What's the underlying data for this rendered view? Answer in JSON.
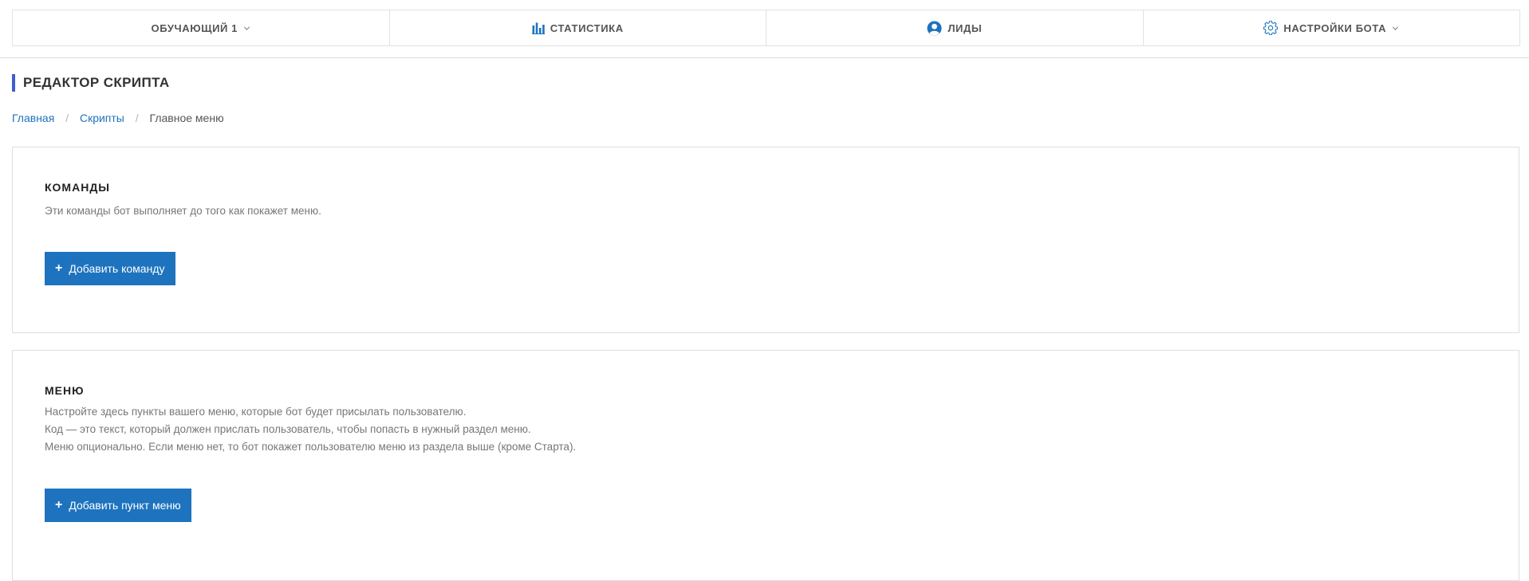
{
  "nav": {
    "items": [
      {
        "label": "ОБУЧАЮЩИЙ 1",
        "icon": "",
        "has_dropdown": true
      },
      {
        "label": "СТАТИСТИКА",
        "icon": "bar-chart-icon",
        "has_dropdown": false
      },
      {
        "label": "ЛИДЫ",
        "icon": "user-icon",
        "has_dropdown": false
      },
      {
        "label": "НАСТРОЙКИ БОТА",
        "icon": "gear-icon",
        "has_dropdown": true
      }
    ]
  },
  "page": {
    "title": "РЕДАКТОР СКРИПТА"
  },
  "breadcrumb": {
    "home": "Главная",
    "scripts": "Скрипты",
    "current": "Главное меню",
    "separator": "/"
  },
  "commands": {
    "title": "КОМАНДЫ",
    "description": "Эти команды бот выполняет до того как покажет меню.",
    "button_label": "Добавить команду"
  },
  "menu": {
    "title": "МЕНЮ",
    "description_lines": [
      "Настройте здесь пункты вашего меню, которые бот будет присылать пользователю.",
      "Код — это текст, который должен прислать пользователь, чтобы попасть в нужный раздел меню.",
      "Меню опционально. Если меню нет, то бот покажет пользователю меню из раздела выше (кроме Старта)."
    ],
    "button_label": "Добавить пункт меню"
  },
  "colors": {
    "accent": "#1e73be",
    "title_bar": "#3c5fd0",
    "muted_text": "#777777"
  }
}
